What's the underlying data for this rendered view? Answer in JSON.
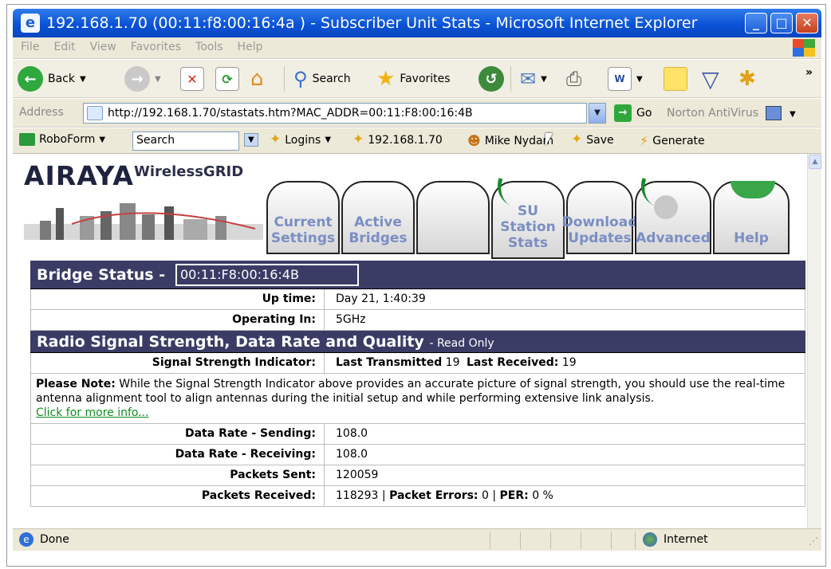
{
  "window": {
    "title": "192.168.1.70 (00:11:f8:00:16:4a ) - Subscriber Unit Stats - Microsoft Internet Explorer"
  },
  "menu": [
    "File",
    "Edit",
    "View",
    "Favorites",
    "Tools",
    "Help"
  ],
  "toolbar": {
    "back_label": "Back",
    "search_label": "Search",
    "favorites_label": "Favorites",
    "chevron": "»"
  },
  "address": {
    "label": "Address",
    "url": "http://192.168.1.70/stastats.htm?MAC_ADDR=00:11:F8:00:16:4B",
    "go_label": "Go",
    "norton_label": "Norton AntiVirus"
  },
  "robobar": {
    "roboform_label": "RoboForm",
    "search_value": "Search",
    "logins_label": "Logins",
    "ip_label": "192.168.1.70",
    "user_label": "Mike Nydam",
    "save_label": "Save",
    "generate_label": "Generate"
  },
  "page": {
    "brand": "AIRAYA",
    "product": "WirelessGRID",
    "tabs": [
      {
        "line1": "Current",
        "line2": "Settings"
      },
      {
        "line1": "Active",
        "line2": "Bridges"
      },
      {
        "line1": "",
        "line2": ""
      },
      {
        "line1": "SU",
        "line2": "Station",
        "line3": "Stats"
      },
      {
        "line1": "Download",
        "line2": "Updates"
      },
      {
        "line1": "Advanced",
        "line2": ""
      },
      {
        "line1": "Help",
        "line2": ""
      }
    ],
    "bridge_status_label": "Bridge Status",
    "bridge_mac": "00:11:F8:00:16:4B",
    "rows1": [
      {
        "k": "Up time:",
        "v": "Day 21, 1:40:39"
      },
      {
        "k": "Operating In:",
        "v": "5GHz"
      }
    ],
    "radio_header": "Radio Signal Strength, Data Rate and Quality",
    "radio_header_suffix": "- Read Only",
    "signal_label": "Signal Strength Indicator:",
    "last_tx_label": "Last Transmitted",
    "last_tx_value": "19",
    "last_rx_label": "Last Received:",
    "last_rx_value": "19",
    "note_bold": "Please Note:",
    "note_text": "While the Signal Strength Indicator above provides an accurate picture of signal strength, you should use the real-time antenna alignment tool to align antennas during the initial setup and while performing extensive link analysis.",
    "note_link": "Click for more info...",
    "rows2": [
      {
        "k": "Data Rate - Sending:",
        "v": "108.0"
      },
      {
        "k": "Data Rate - Receiving:",
        "v": "108.0"
      },
      {
        "k": "Packets Sent:",
        "v": "120059"
      }
    ],
    "packets_received_label": "Packets Received:",
    "packets_received_value": "118293",
    "packet_errors_label": "Packet Errors:",
    "packet_errors_value": "0",
    "per_label": "PER:",
    "per_value": "0 %"
  },
  "status": {
    "text": "Done",
    "zone": "Internet"
  }
}
